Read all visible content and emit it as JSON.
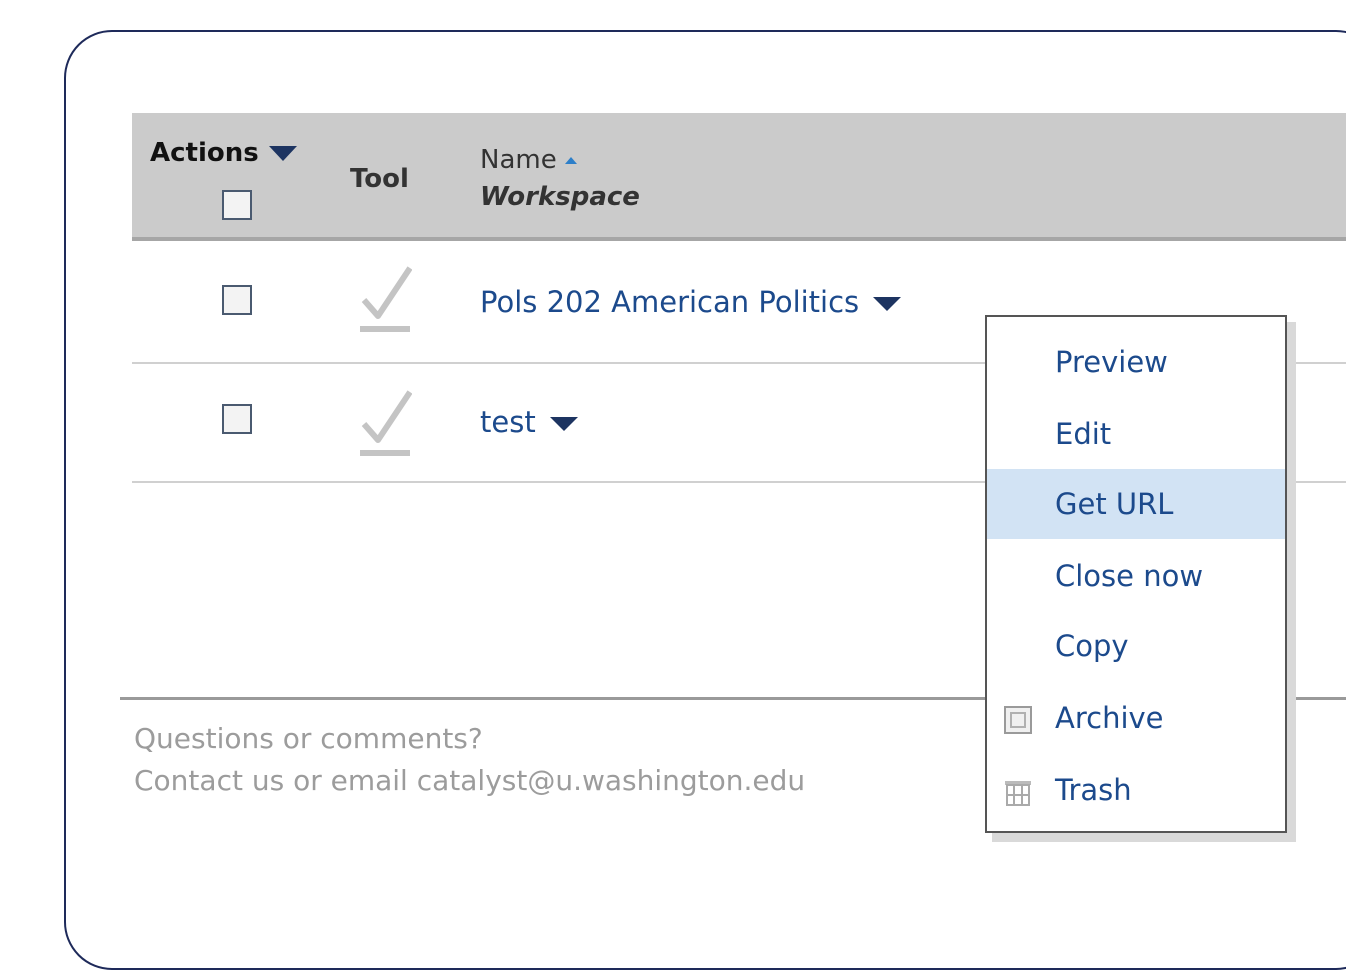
{
  "table": {
    "header": {
      "actions_label": "Actions",
      "tool_label": "Tool",
      "name_label": "Name",
      "workspace_label": "Workspace"
    },
    "rows": [
      {
        "name": "Pols 202 American Politics"
      },
      {
        "name": "test"
      }
    ]
  },
  "context_menu": {
    "items": [
      {
        "label": "Preview"
      },
      {
        "label": "Edit"
      },
      {
        "label": "Get URL"
      },
      {
        "label": "Close now"
      },
      {
        "label": "Copy"
      },
      {
        "label": "Archive",
        "icon": "archive-icon"
      },
      {
        "label": "Trash",
        "icon": "trash-icon"
      }
    ],
    "highlighted": "Get URL"
  },
  "footer": {
    "line1": "Questions or comments?",
    "line2": "Contact us or email catalyst@u.washington.edu"
  },
  "colors": {
    "link": "#1c4a8c",
    "header_bg": "#cbcbcb",
    "highlight": "#d2e3f4",
    "frame_border": "#1e2a5a"
  }
}
